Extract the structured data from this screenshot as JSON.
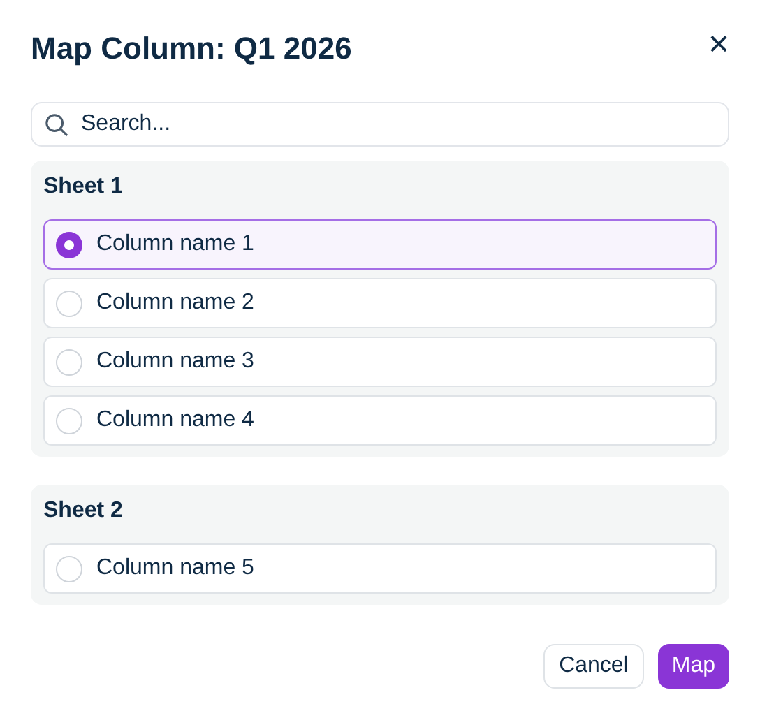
{
  "dialog": {
    "title": "Map Column: Q1 2026",
    "close_icon": "×"
  },
  "search": {
    "placeholder": "Search..."
  },
  "sheets": [
    {
      "name": "Sheet 1",
      "columns": [
        {
          "label": "Column name 1",
          "selected": true
        },
        {
          "label": "Column name 2",
          "selected": false
        },
        {
          "label": "Column name 3",
          "selected": false
        },
        {
          "label": "Column name 4",
          "selected": false
        }
      ]
    },
    {
      "name": "Sheet 2",
      "columns": [
        {
          "label": "Column name 5",
          "selected": false
        }
      ]
    }
  ],
  "buttons": [
    {
      "label": "Cancel",
      "kind": "secondary"
    },
    {
      "label": "Map",
      "kind": "primary"
    }
  ]
}
